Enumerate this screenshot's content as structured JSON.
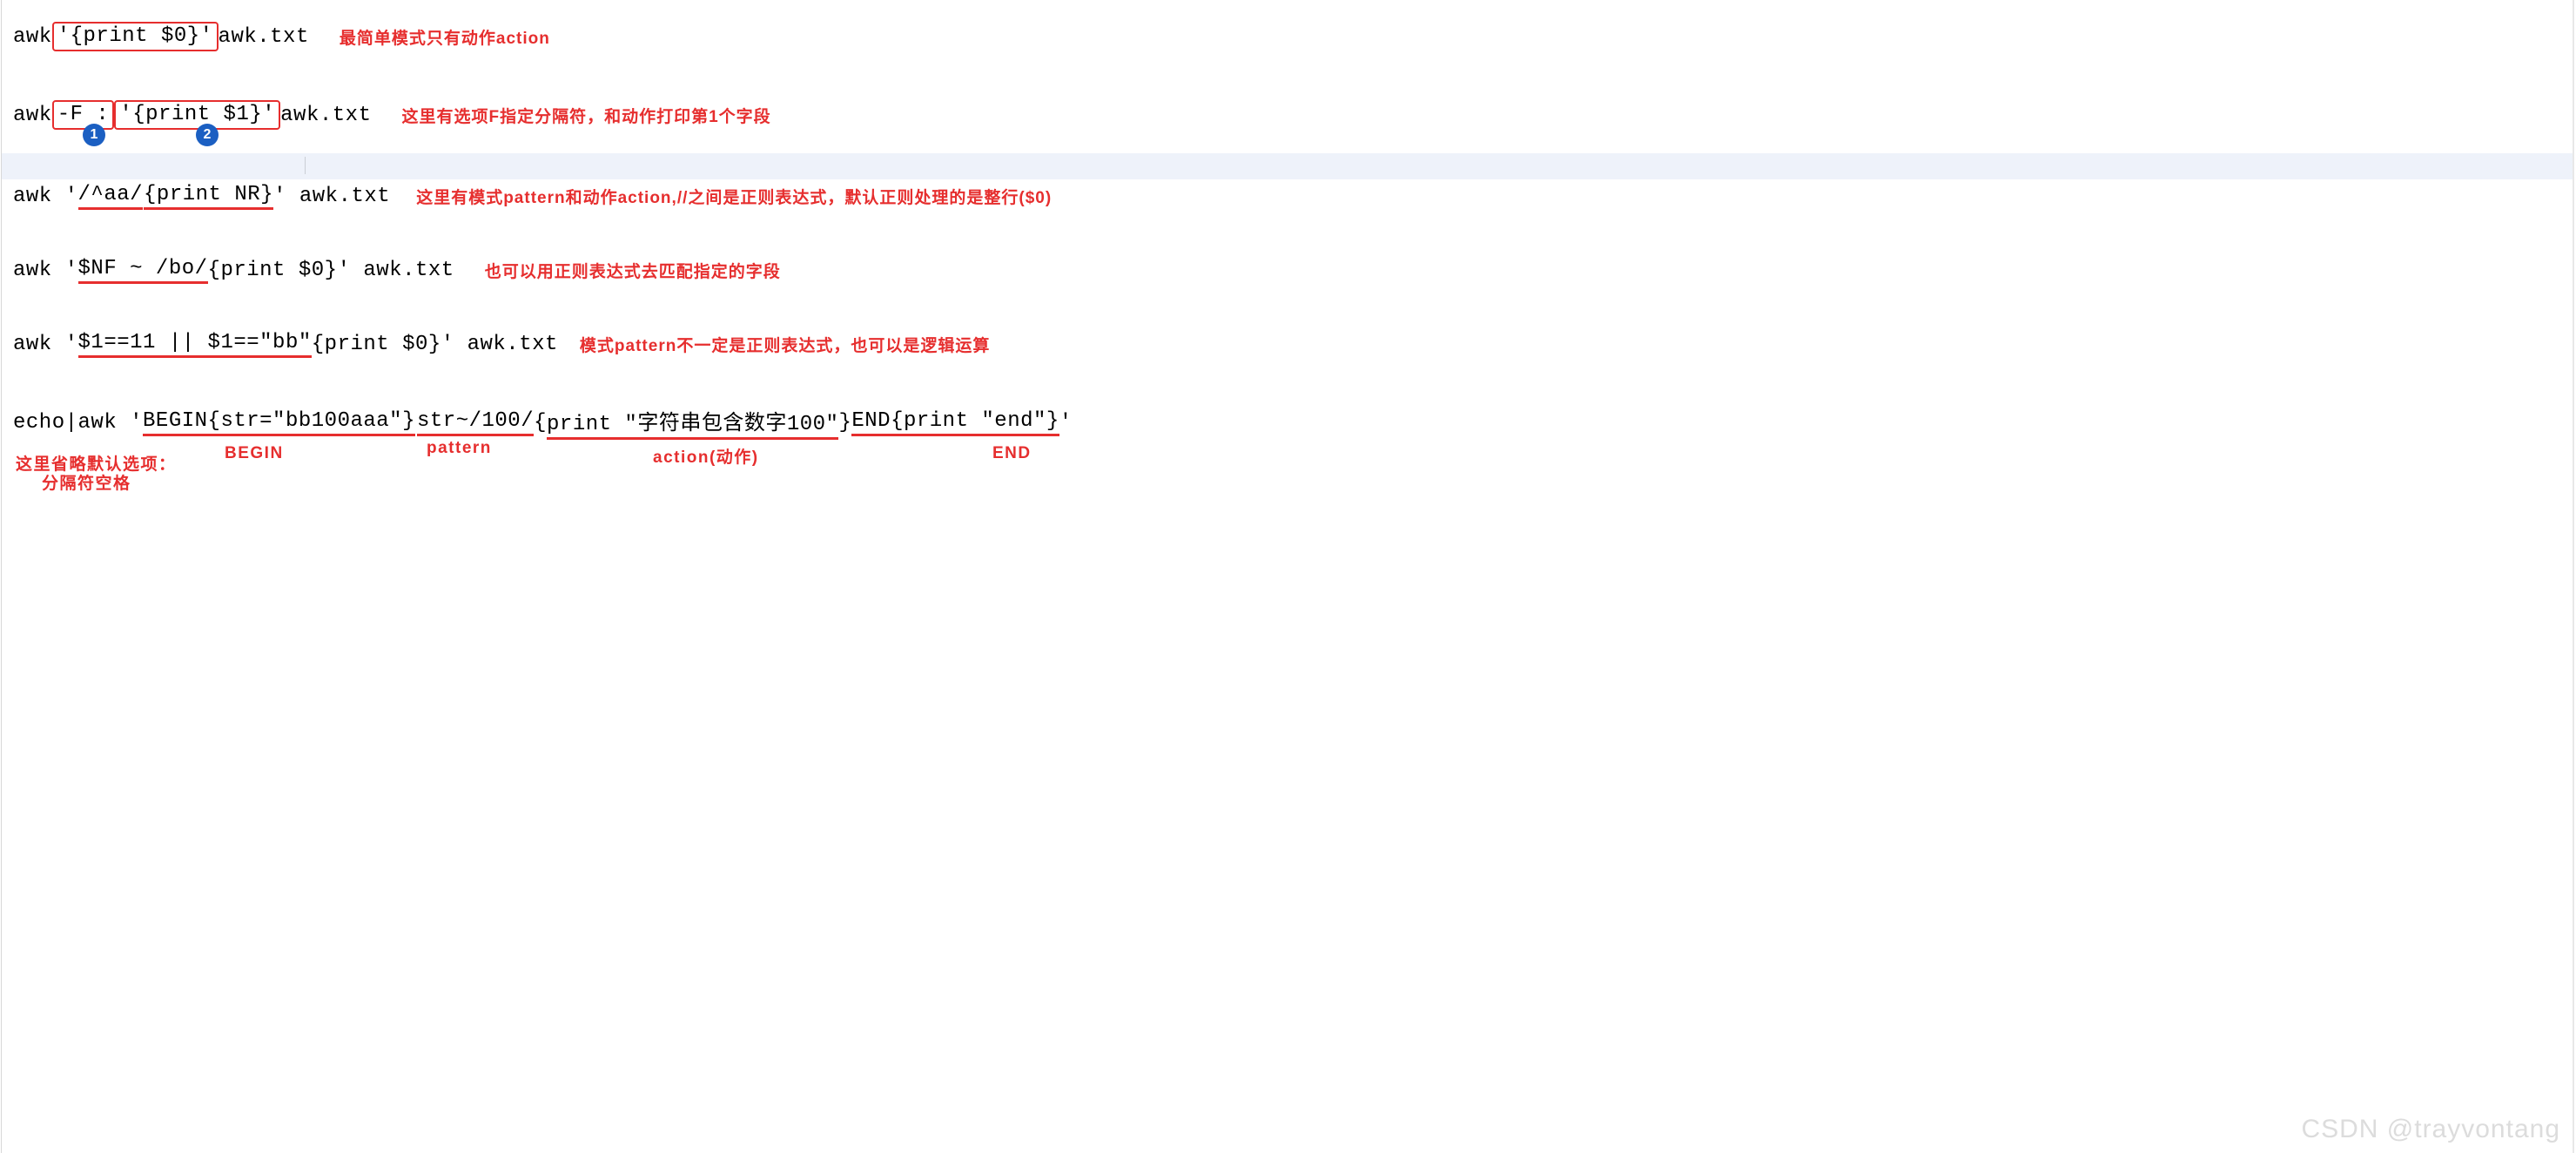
{
  "line1": {
    "pre": "awk ",
    "boxed": "'{print $0}'",
    "post": " awk.txt",
    "comment": "最简单模式只有动作action"
  },
  "line2": {
    "pre": "awk ",
    "box1": "-F :",
    "gap": " ",
    "box2": "'{print $1}'",
    "post": " awk.txt",
    "comment": "这里有选项F指定分隔符，和动作打印第1个字段",
    "badge1": "1",
    "badge2": "2"
  },
  "line3": {
    "pre": "awk '",
    "u1": "/^aa/",
    "u2": "{print NR}",
    "post": "' awk.txt",
    "comment": "这里有模式pattern和动作action,//之间是正则表达式，默认正则处理的是整行($0)"
  },
  "line4": {
    "pre": "awk '",
    "u1": "$NF ~ /bo/",
    "post": "{print $0}' awk.txt",
    "comment": "也可以用正则表达式去匹配指定的字段"
  },
  "line5": {
    "pre": "awk '",
    "u1": "$1==11 || $1==\"bb\"",
    "post": "{print $0}' awk.txt",
    "comment": "模式pattern不一定是正则表达式，也可以是逻辑运算"
  },
  "line6": {
    "pre": "echo|awk '",
    "u1": "BEGIN{str=\"bb100aaa\"}",
    "u2": "str~/100/",
    "mid1": "{",
    "u3": "print \"字符串包含数字100\"",
    "mid2": "}",
    "u4": "END{print \"end\"}",
    "post": "'"
  },
  "labels": {
    "omit1": "这里省略默认选项：",
    "omit2": "分隔符空格",
    "begin": "BEGIN",
    "pattern": "pattern",
    "action": "action(动作)",
    "end": "END"
  },
  "watermark": "CSDN @trayvontang"
}
